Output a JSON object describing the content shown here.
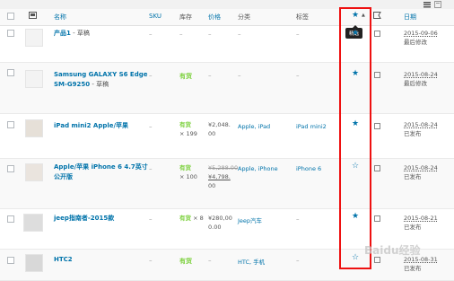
{
  "headers": {
    "name": "名称",
    "sku": "SKU",
    "stock": "库存",
    "price": "价格",
    "categories": "分类",
    "tags": "标签",
    "featured_star": "★",
    "featured_arrow": "▲",
    "date": "日期"
  },
  "tooltip": "精选",
  "rows": [
    {
      "name": "产品1",
      "status_suffix": " - 草稿",
      "sku": "–",
      "stock": "–",
      "stock_qty": "",
      "price_lines": [
        "–"
      ],
      "price_strike": "",
      "categories": "–",
      "tags": "–",
      "featured": "★",
      "date": "2015-09-06",
      "date_status": "最后修改"
    },
    {
      "name": "Samsung GALAXY S6 Edge SM-G9250",
      "status_suffix": " - 草稿",
      "sku": "–",
      "stock": "有货",
      "stock_qty": "",
      "price_lines": [
        "–"
      ],
      "price_strike": "",
      "categories": "–",
      "tags": "–",
      "featured": "★",
      "date": "2015-08-24",
      "date_status": "最后修改"
    },
    {
      "name": "iPad mini2 Apple/苹果",
      "status_suffix": "",
      "sku": "–",
      "stock": "有货",
      "stock_qty": "× 199",
      "price_lines": [
        "¥2,048.",
        "00"
      ],
      "price_strike": "",
      "categories": "Apple, iPad",
      "tags": "iPad mini2",
      "featured": "★",
      "date": "2015-08-24",
      "date_status": "已发布"
    },
    {
      "name": "Apple/苹果 iPhone 6 4.7英寸 公开版",
      "status_suffix": "",
      "sku": "–",
      "stock": "有货",
      "stock_qty": "× 100",
      "price_lines": [
        "¥4,798.",
        "00"
      ],
      "price_strike": "¥5,288.00",
      "categories": "Apple, iPhone",
      "tags": "iPhone 6",
      "featured": "☆",
      "date": "2015-08-24",
      "date_status": "已发布"
    },
    {
      "name": "jeep指南者-2015款",
      "status_suffix": "",
      "sku": "–",
      "stock": "有货",
      "stock_qty": "× 8",
      "price_lines": [
        "¥280,00",
        "0.00"
      ],
      "price_strike": "",
      "categories": "Jeep汽车",
      "tags": "–",
      "featured": "★",
      "date": "2015-08-21",
      "date_status": "已发布"
    },
    {
      "name": "HTC2",
      "status_suffix": "",
      "sku": "–",
      "stock": "有货",
      "stock_qty": "",
      "price_lines": [
        "–"
      ],
      "price_strike": "",
      "categories": "HTC, 手机",
      "tags": "–",
      "featured": "☆",
      "date": "2015-08-31",
      "date_status": "已发布"
    }
  ],
  "watermark": "Baidu经验",
  "colors": {
    "link": "#0073aa",
    "instock": "#7ad03a",
    "highlight_box": "#ee1111"
  }
}
